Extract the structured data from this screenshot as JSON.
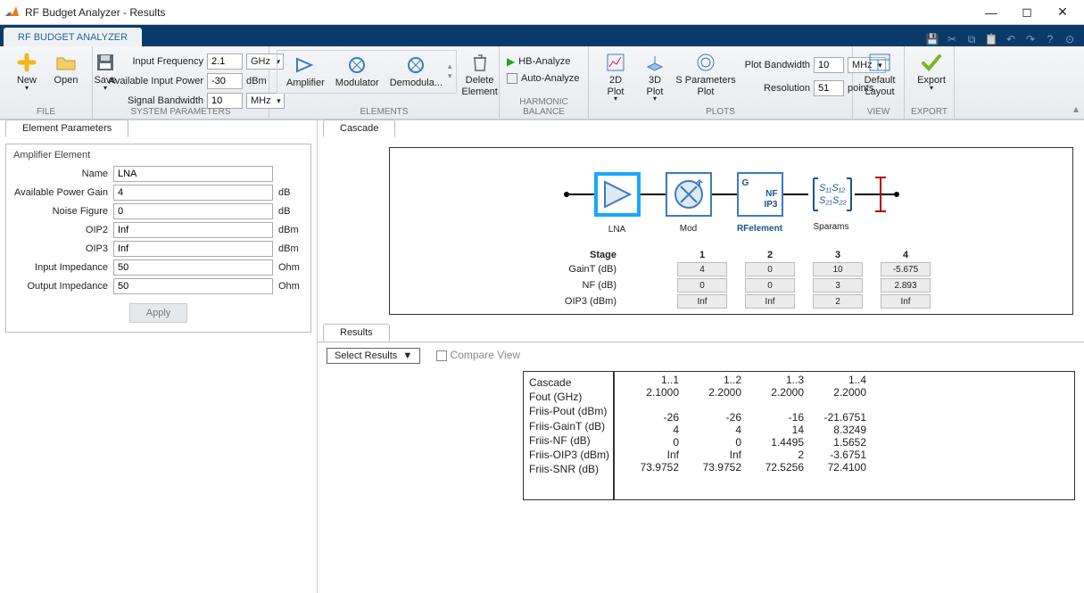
{
  "window": {
    "title": "RF Budget Analyzer - Results"
  },
  "ribbon": {
    "tab": "RF BUDGET ANALYZER"
  },
  "file": {
    "new": "New",
    "open": "Open",
    "save": "Save",
    "group": "FILE"
  },
  "sysparams": {
    "group": "SYSTEM PARAMETERS",
    "input_freq_label": "Input Frequency",
    "input_freq": "2.1",
    "input_freq_unit": "GHz",
    "avail_power_label": "Available Input Power",
    "avail_power": "-30",
    "avail_power_unit": "dBm",
    "sigbw_label": "Signal Bandwidth",
    "sigbw": "10",
    "sigbw_unit": "MHz"
  },
  "elements": {
    "group": "ELEMENTS",
    "amplifier": "Amplifier",
    "modulator": "Modulator",
    "demod": "Demodula...",
    "delete": "Delete\nElement"
  },
  "hb": {
    "group": "HARMONIC BALANCE",
    "analyze": "HB-Analyze",
    "auto": "Auto-Analyze"
  },
  "plots": {
    "group": "PLOTS",
    "p2d": "2D\nPlot",
    "p3d": "3D\nPlot",
    "sparam": "S Parameters\nPlot",
    "pbw_label": "Plot Bandwidth",
    "pbw": "10",
    "pbw_unit": "MHz",
    "res_label": "Resolution",
    "res": "51",
    "res_unit": "points"
  },
  "view": {
    "group": "VIEW",
    "deflayout": "Default\nLayout"
  },
  "export": {
    "group": "EXPORT",
    "export": "Export"
  },
  "elemparam": {
    "tab": "Element Parameters",
    "title": "Amplifier Element",
    "name_l": "Name",
    "name": "LNA",
    "gain_l": "Available Power Gain",
    "gain": "4",
    "gain_u": "dB",
    "nf_l": "Noise Figure",
    "nf": "0",
    "nf_u": "dB",
    "oip2_l": "OIP2",
    "oip2": "Inf",
    "oip2_u": "dBm",
    "oip3_l": "OIP3",
    "oip3": "Inf",
    "oip3_u": "dBm",
    "zin_l": "Input Impedance",
    "zin": "50",
    "zin_u": "Ohm",
    "zout_l": "Output Impedance",
    "zout": "50",
    "zout_u": "Ohm",
    "apply": "Apply"
  },
  "cascade": {
    "tab": "Cascade",
    "nodes": [
      "LNA",
      "Mod",
      "RFelement",
      "Sparams"
    ],
    "stage": "Stage",
    "gaintl": "GainT (dB)",
    "nfl": "NF (dB)",
    "oip3l": "OIP3 (dBm)",
    "idx": [
      "1",
      "2",
      "3",
      "4"
    ],
    "gaint": [
      "4",
      "0",
      "10",
      "-5.675"
    ],
    "nf": [
      "0",
      "0",
      "3",
      "2.893"
    ],
    "oip3": [
      "Inf",
      "Inf",
      "2",
      "Inf"
    ]
  },
  "results": {
    "tab": "Results",
    "select": "Select Results",
    "compare": "Compare View",
    "rows": [
      "Cascade",
      "Fout (GHz)",
      "",
      "Friis-Pout (dBm)",
      "Friis-GainT (dB)",
      "Friis-NF (dB)",
      "Friis-OIP3 (dBm)",
      "Friis-SNR (dB)"
    ],
    "cols": [
      "1..1",
      "1..2",
      "1..3",
      "1..4"
    ],
    "fout": [
      "2.1000",
      "2.2000",
      "2.2000",
      "2.2000"
    ],
    "pout": [
      "-26",
      "-26",
      "-16",
      "-21.6751"
    ],
    "gaint": [
      "4",
      "4",
      "14",
      "8.3249"
    ],
    "nf": [
      "0",
      "0",
      "1.4495",
      "1.5652"
    ],
    "oip3": [
      "Inf",
      "Inf",
      "2",
      "-3.6751"
    ],
    "snr": [
      "73.9752",
      "73.9752",
      "72.5256",
      "72.4100"
    ]
  }
}
